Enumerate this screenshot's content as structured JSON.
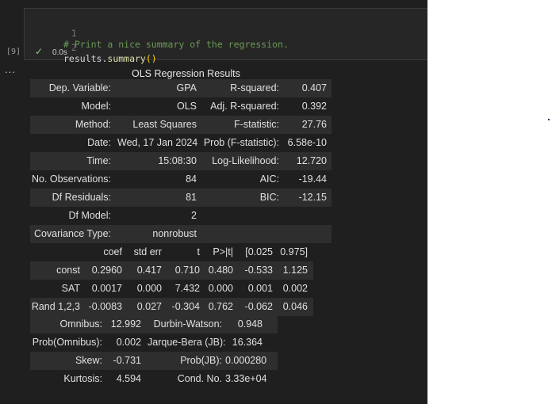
{
  "editor": {
    "lines": [
      {
        "number": "1",
        "comment": "# Print a nice summary of the regression."
      },
      {
        "number": "2",
        "ident": "results.",
        "fn": "summary",
        "paren": "()"
      }
    ]
  },
  "cell": {
    "execution_count": "[9]",
    "status_icon": "check-icon",
    "timing": "0.0s"
  },
  "output_menu": "...",
  "summary": {
    "caption": "OLS Regression Results",
    "header_rows": [
      [
        "Dep. Variable:",
        "GPA",
        "R-squared:",
        "0.407"
      ],
      [
        "Model:",
        "OLS",
        "Adj. R-squared:",
        "0.392"
      ],
      [
        "Method:",
        "Least Squares",
        "F-statistic:",
        "27.76"
      ],
      [
        "Date:",
        "Wed, 17 Jan 2024",
        "Prob (F-statistic):",
        "6.58e-10"
      ],
      [
        "Time:",
        "15:08:30",
        "Log-Likelihood:",
        "12.720"
      ],
      [
        "No. Observations:",
        "84",
        "AIC:",
        "-19.44"
      ],
      [
        "Df Residuals:",
        "81",
        "BIC:",
        "-12.15"
      ],
      [
        "Df Model:",
        "2",
        "",
        ""
      ],
      [
        "Covariance Type:",
        "nonrobust",
        "",
        ""
      ]
    ],
    "coef_header": [
      "",
      "coef",
      "std err",
      "t",
      "P>|t|",
      "[0.025",
      "0.975]"
    ],
    "coef_rows": [
      [
        "const",
        "0.2960",
        "0.417",
        "0.710",
        "0.480",
        "-0.533",
        "1.125"
      ],
      [
        "SAT",
        "0.0017",
        "0.000",
        "7.432",
        "0.000",
        "0.001",
        "0.002"
      ],
      [
        "Rand 1,2,3",
        "-0.0083",
        "0.027",
        "-0.304",
        "0.762",
        "-0.062",
        "0.046"
      ]
    ],
    "diag_rows": [
      [
        "Omnibus:",
        "12.992",
        "Durbin-Watson:",
        "0.948"
      ],
      [
        "Prob(Omnibus):",
        "0.002",
        "Jarque-Bera (JB):",
        "16.364"
      ],
      [
        "Skew:",
        "-0.731",
        "Prob(JB):",
        "0.000280"
      ],
      [
        "Kurtosis:",
        "4.594",
        "Cond. No.",
        "3.33e+04"
      ]
    ]
  }
}
